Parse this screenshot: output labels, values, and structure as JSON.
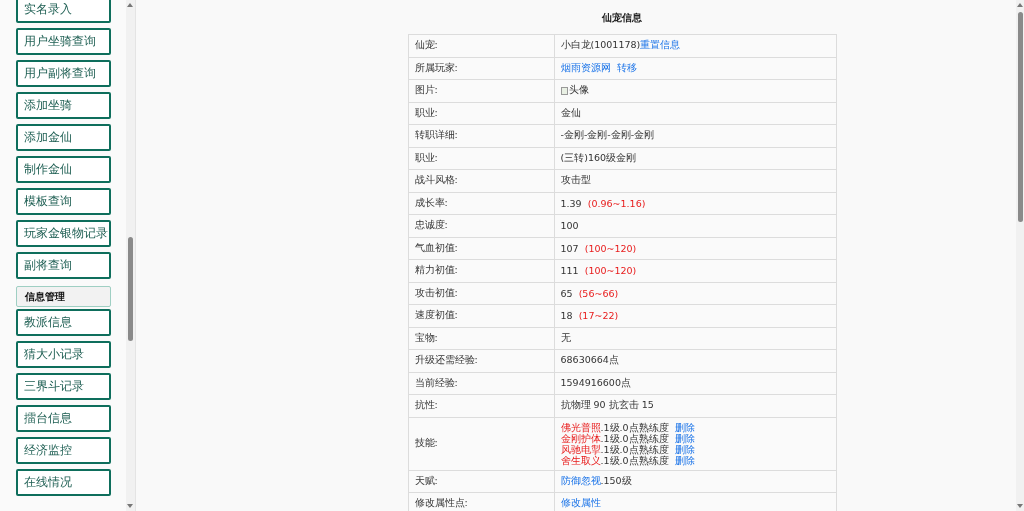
{
  "sidebar": {
    "items_top": [
      {
        "label": "实名录入"
      },
      {
        "label": "用户坐骑查询"
      },
      {
        "label": "用户副将查询"
      },
      {
        "label": "添加坐骑"
      },
      {
        "label": "添加金仙"
      },
      {
        "label": "制作金仙"
      },
      {
        "label": "模板查询"
      },
      {
        "label": "玩家金银物记录"
      },
      {
        "label": "副将查询"
      }
    ],
    "section": {
      "title": "信息管理"
    },
    "items_bottom": [
      {
        "label": "教派信息"
      },
      {
        "label": "猜大小记录"
      },
      {
        "label": "三界斗记录"
      },
      {
        "label": "擂台信息"
      },
      {
        "label": "经济监控"
      },
      {
        "label": "在线情况"
      }
    ]
  },
  "panel": {
    "title": "仙宠信息",
    "rows": [
      {
        "label": "仙宠:",
        "value": [
          {
            "kind": "text",
            "text": "小白龙(1001178)"
          },
          {
            "kind": "link",
            "text": "重置信息"
          }
        ]
      },
      {
        "label": "所属玩家:",
        "value": [
          {
            "kind": "link",
            "text": "烟雨资源网"
          },
          {
            "kind": "link",
            "text": "转移"
          }
        ]
      },
      {
        "label": "图片:",
        "value": [
          {
            "kind": "image",
            "text": "头像"
          }
        ]
      },
      {
        "label": "职业:",
        "value": [
          {
            "kind": "text",
            "text": "金仙"
          }
        ]
      },
      {
        "label": "转职详细:",
        "value": [
          {
            "kind": "text",
            "text": "-金刚-金刚-金刚-金刚"
          }
        ]
      },
      {
        "label": "职业:",
        "value": [
          {
            "kind": "text",
            "text": "(三转)160级金刚"
          }
        ]
      },
      {
        "label": "战斗风格:",
        "value": [
          {
            "kind": "text",
            "text": "攻击型"
          }
        ]
      },
      {
        "label": "成长率:",
        "value": [
          {
            "kind": "text",
            "text": "1.39"
          },
          {
            "kind": "range",
            "text": "(0.96~1.16)"
          }
        ]
      },
      {
        "label": "忠诚度:",
        "value": [
          {
            "kind": "text",
            "text": "100"
          }
        ]
      },
      {
        "label": "气血初值:",
        "value": [
          {
            "kind": "text",
            "text": "107"
          },
          {
            "kind": "range",
            "text": "(100~120)"
          }
        ]
      },
      {
        "label": "精力初值:",
        "value": [
          {
            "kind": "text",
            "text": "111"
          },
          {
            "kind": "range",
            "text": "(100~120)"
          }
        ]
      },
      {
        "label": "攻击初值:",
        "value": [
          {
            "kind": "text",
            "text": "65"
          },
          {
            "kind": "range",
            "text": "(56~66)"
          }
        ]
      },
      {
        "label": "速度初值:",
        "value": [
          {
            "kind": "text",
            "text": "18"
          },
          {
            "kind": "range",
            "text": "(17~22)"
          }
        ]
      },
      {
        "label": "宝物:",
        "value": [
          {
            "kind": "text",
            "text": "无"
          }
        ]
      },
      {
        "label": "升级还需经验:",
        "value": [
          {
            "kind": "text",
            "text": "68630664点"
          }
        ]
      },
      {
        "label": "当前经验:",
        "value": [
          {
            "kind": "text",
            "text": "1594916600点"
          }
        ]
      },
      {
        "label": "抗性:",
        "value": [
          {
            "kind": "text",
            "text": "抗物理 90 抗玄击 15"
          }
        ]
      },
      {
        "label": "技能:",
        "skills": [
          {
            "name": "佛光普照",
            "detail": ".1级.0点熟练度",
            "action": "删除"
          },
          {
            "name": "金刚护体",
            "detail": ".1级.0点熟练度",
            "action": "删除"
          },
          {
            "name": "风驰电掣",
            "detail": ".1级.0点熟练度",
            "action": "删除"
          },
          {
            "name": "舍生取义",
            "detail": ".1级.0点熟练度",
            "action": "删除"
          }
        ]
      },
      {
        "label": "天赋:",
        "value": [
          {
            "kind": "link",
            "text": "防御忽视"
          },
          {
            "kind": "text",
            "text": ".150级"
          }
        ]
      },
      {
        "label": "修改属性点:",
        "value": [
          {
            "kind": "link",
            "text": "修改属性"
          }
        ]
      }
    ]
  }
}
